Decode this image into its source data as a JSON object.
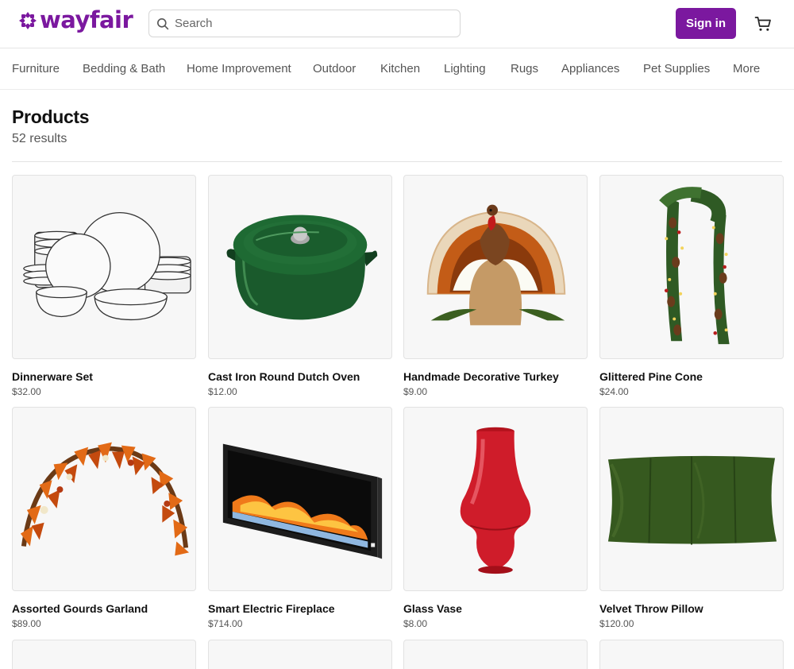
{
  "brand": {
    "name": "wayfair",
    "color": "#7b189f"
  },
  "search": {
    "placeholder": "Search"
  },
  "header": {
    "sign_in_label": "Sign in"
  },
  "nav": {
    "items": [
      "Furniture",
      "Bedding & Bath",
      "Home Improvement",
      "Outdoor",
      "Kitchen",
      "Lighting",
      "Rugs",
      "Appliances",
      "Pet Supplies",
      "More"
    ]
  },
  "page": {
    "title": "Products",
    "results": "52 results"
  },
  "products": [
    {
      "name": "Dinnerware Set",
      "price": "$32.00",
      "image": "dinnerware-image"
    },
    {
      "name": "Cast Iron Round Dutch Oven",
      "price": "$12.00",
      "image": "dutch-oven-image"
    },
    {
      "name": "Handmade Decorative Turkey",
      "price": "$9.00",
      "image": "turkey-image"
    },
    {
      "name": "Glittered Pine Cone",
      "price": "$24.00",
      "image": "pine-garland-image"
    },
    {
      "name": "Assorted Gourds Garland",
      "price": "$89.00",
      "image": "autumn-garland-image"
    },
    {
      "name": "Smart Electric Fireplace",
      "price": "$714.00",
      "image": "fireplace-image"
    },
    {
      "name": "Glass Vase",
      "price": "$8.00",
      "image": "vase-image"
    },
    {
      "name": "Velvet Throw Pillow",
      "price": "$120.00",
      "image": "pillow-image"
    }
  ],
  "icons": {
    "search": "search-icon",
    "cart": "cart-icon",
    "logo": "wayfair-logo-icon"
  },
  "colors": {
    "accent": "#7b189f",
    "border": "#e2e2e2",
    "muted_text": "#555555"
  }
}
